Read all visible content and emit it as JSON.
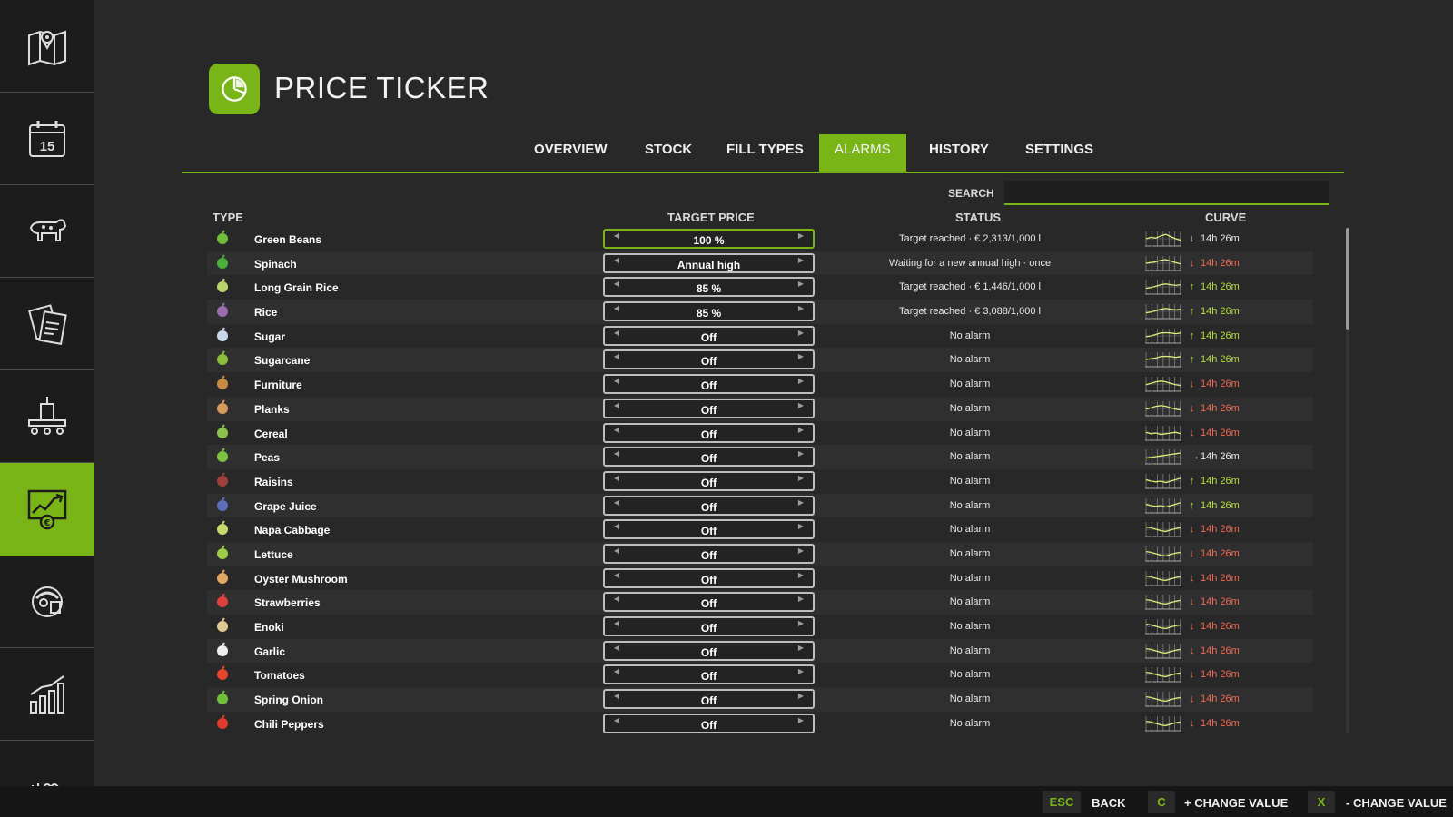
{
  "sidebar": {
    "items": [
      {
        "icon": "map-icon",
        "active": false
      },
      {
        "icon": "calendar-icon",
        "active": false,
        "label": "15"
      },
      {
        "icon": "livestock-icon",
        "active": false
      },
      {
        "icon": "contracts-icon",
        "active": false
      },
      {
        "icon": "production-icon",
        "active": false
      },
      {
        "icon": "price-chart-icon",
        "active": true
      },
      {
        "icon": "worker-icon",
        "active": false
      },
      {
        "icon": "statistics-icon",
        "active": false
      },
      {
        "icon": "more-icon",
        "active": false
      }
    ]
  },
  "header": {
    "title": "PRICE TICKER",
    "icon": "pie-chart-icon"
  },
  "tabs": [
    {
      "label": "OVERVIEW",
      "active": false
    },
    {
      "label": "STOCK",
      "active": false
    },
    {
      "label": "FILL TYPES",
      "active": false
    },
    {
      "label": "ALARMS",
      "active": true
    },
    {
      "label": "HISTORY",
      "active": false
    },
    {
      "label": "SETTINGS",
      "active": false
    }
  ],
  "search": {
    "label": "SEARCH",
    "placeholder": ""
  },
  "columns": {
    "type": "TYPE",
    "target": "TARGET PRICE",
    "status": "STATUS",
    "curve": "CURVE"
  },
  "rows": [
    {
      "name": "Green Beans",
      "icon": "green-beans-icon",
      "icon_color": "#6fbf3a",
      "target": "100 %",
      "status": "Target reached · € 2,313/1,000 l",
      "trend": "down",
      "trend_arrow": "↓",
      "time": "14h 26m",
      "time_color": "neutral",
      "curve": [
        0.5,
        0.4,
        0.45,
        0.3,
        0.2,
        0.35,
        0.5,
        0.6
      ]
    },
    {
      "name": "Spinach",
      "icon": "spinach-icon",
      "icon_color": "#4caf3a",
      "target": "Annual high",
      "status": "Waiting for a new annual high · once",
      "trend": "down",
      "trend_arrow": "↓",
      "time": "14h 26m",
      "time_color": "down",
      "curve": [
        0.5,
        0.45,
        0.4,
        0.3,
        0.25,
        0.35,
        0.45,
        0.55
      ]
    },
    {
      "name": "Long Grain Rice",
      "icon": "long-grain-rice-icon",
      "icon_color": "#b8d36a",
      "target": "85 %",
      "status": "Target reached · € 1,446/1,000 l",
      "trend": "up",
      "trend_arrow": "↑",
      "time": "14h 26m",
      "time_color": "up",
      "curve": [
        0.6,
        0.55,
        0.45,
        0.35,
        0.3,
        0.35,
        0.4,
        0.35
      ]
    },
    {
      "name": "Rice",
      "icon": "rice-icon",
      "icon_color": "#9a6cae",
      "target": "85 %",
      "status": "Target reached · € 3,088/1,000 l",
      "trend": "up",
      "trend_arrow": "↑",
      "time": "14h 26m",
      "time_color": "up",
      "curve": [
        0.6,
        0.55,
        0.45,
        0.35,
        0.3,
        0.35,
        0.4,
        0.35
      ]
    },
    {
      "name": "Sugar",
      "icon": "sugar-icon",
      "icon_color": "#c9d6ea",
      "target": "Off",
      "status": "No alarm",
      "trend": "up",
      "trend_arrow": "↑",
      "time": "14h 26m",
      "time_color": "up",
      "curve": [
        0.55,
        0.5,
        0.4,
        0.3,
        0.28,
        0.3,
        0.35,
        0.3
      ]
    },
    {
      "name": "Sugarcane",
      "icon": "sugarcane-icon",
      "icon_color": "#8bbf3a",
      "target": "Off",
      "status": "No alarm",
      "trend": "up",
      "trend_arrow": "↑",
      "time": "14h 26m",
      "time_color": "up",
      "curve": [
        0.5,
        0.45,
        0.4,
        0.3,
        0.28,
        0.3,
        0.35,
        0.3
      ]
    },
    {
      "name": "Furniture",
      "icon": "furniture-icon",
      "icon_color": "#c98a45",
      "target": "Off",
      "status": "No alarm",
      "trend": "down",
      "trend_arrow": "↓",
      "time": "14h 26m",
      "time_color": "down",
      "curve": [
        0.55,
        0.45,
        0.35,
        0.3,
        0.35,
        0.45,
        0.55,
        0.6
      ]
    },
    {
      "name": "Planks",
      "icon": "planks-icon",
      "icon_color": "#d49a5a",
      "target": "Off",
      "status": "No alarm",
      "trend": "down",
      "trend_arrow": "↓",
      "time": "14h 26m",
      "time_color": "down",
      "curve": [
        0.55,
        0.45,
        0.35,
        0.3,
        0.35,
        0.45,
        0.55,
        0.6
      ]
    },
    {
      "name": "Cereal",
      "icon": "cereal-icon",
      "icon_color": "#8bc34a",
      "target": "Off",
      "status": "No alarm",
      "trend": "down",
      "trend_arrow": "↓",
      "time": "14h 26m",
      "time_color": "down",
      "curve": [
        0.45,
        0.55,
        0.5,
        0.6,
        0.55,
        0.5,
        0.45,
        0.55
      ]
    },
    {
      "name": "Peas",
      "icon": "peas-icon",
      "icon_color": "#7cc242",
      "target": "Off",
      "status": "No alarm",
      "trend": "neutral",
      "trend_arrow": "→",
      "time": "14h 26m",
      "time_color": "neutral",
      "curve": [
        0.6,
        0.55,
        0.5,
        0.45,
        0.4,
        0.35,
        0.3,
        0.25
      ]
    },
    {
      "name": "Raisins",
      "icon": "raisins-icon",
      "icon_color": "#a0403a",
      "target": "Off",
      "status": "No alarm",
      "trend": "up",
      "trend_arrow": "↑",
      "time": "14h 26m",
      "time_color": "up",
      "curve": [
        0.4,
        0.5,
        0.55,
        0.5,
        0.6,
        0.5,
        0.4,
        0.3
      ]
    },
    {
      "name": "Grape Juice",
      "icon": "grape-juice-icon",
      "icon_color": "#5a6fb8",
      "target": "Off",
      "status": "No alarm",
      "trend": "up",
      "trend_arrow": "↑",
      "time": "14h 26m",
      "time_color": "up",
      "curve": [
        0.4,
        0.5,
        0.55,
        0.5,
        0.6,
        0.5,
        0.4,
        0.3
      ]
    },
    {
      "name": "Napa Cabbage",
      "icon": "napa-cabbage-icon",
      "icon_color": "#c8d86a",
      "target": "Off",
      "status": "No alarm",
      "trend": "down",
      "trend_arrow": "↓",
      "time": "14h 26m",
      "time_color": "down",
      "curve": [
        0.35,
        0.4,
        0.5,
        0.6,
        0.65,
        0.55,
        0.45,
        0.4
      ]
    },
    {
      "name": "Lettuce",
      "icon": "lettuce-icon",
      "icon_color": "#9ccc45",
      "target": "Off",
      "status": "No alarm",
      "trend": "down",
      "trend_arrow": "↓",
      "time": "14h 26m",
      "time_color": "down",
      "curve": [
        0.35,
        0.4,
        0.5,
        0.6,
        0.65,
        0.55,
        0.45,
        0.4
      ]
    },
    {
      "name": "Oyster Mushroom",
      "icon": "oyster-mushroom-icon",
      "icon_color": "#e0a860",
      "target": "Off",
      "status": "No alarm",
      "trend": "down",
      "trend_arrow": "↓",
      "time": "14h 26m",
      "time_color": "down",
      "curve": [
        0.35,
        0.4,
        0.5,
        0.6,
        0.65,
        0.55,
        0.45,
        0.4
      ]
    },
    {
      "name": "Strawberries",
      "icon": "strawberries-icon",
      "icon_color": "#e04040",
      "target": "Off",
      "status": "No alarm",
      "trend": "down",
      "trend_arrow": "↓",
      "time": "14h 26m",
      "time_color": "down",
      "curve": [
        0.35,
        0.4,
        0.5,
        0.6,
        0.65,
        0.55,
        0.45,
        0.4
      ]
    },
    {
      "name": "Enoki",
      "icon": "enoki-icon",
      "icon_color": "#e0c890",
      "target": "Off",
      "status": "No alarm",
      "trend": "down",
      "trend_arrow": "↓",
      "time": "14h 26m",
      "time_color": "down",
      "curve": [
        0.35,
        0.4,
        0.5,
        0.6,
        0.65,
        0.55,
        0.45,
        0.4
      ]
    },
    {
      "name": "Garlic",
      "icon": "garlic-icon",
      "icon_color": "#eeeeee",
      "target": "Off",
      "status": "No alarm",
      "trend": "down",
      "trend_arrow": "↓",
      "time": "14h 26m",
      "time_color": "down",
      "curve": [
        0.35,
        0.4,
        0.5,
        0.6,
        0.65,
        0.55,
        0.45,
        0.4
      ]
    },
    {
      "name": "Tomatoes",
      "icon": "tomatoes-icon",
      "icon_color": "#e8452a",
      "target": "Off",
      "status": "No alarm",
      "trend": "down",
      "trend_arrow": "↓",
      "time": "14h 26m",
      "time_color": "down",
      "curve": [
        0.35,
        0.4,
        0.5,
        0.6,
        0.65,
        0.55,
        0.45,
        0.4
      ]
    },
    {
      "name": "Spring Onion",
      "icon": "spring-onion-icon",
      "icon_color": "#6fbf3a",
      "target": "Off",
      "status": "No alarm",
      "trend": "down",
      "trend_arrow": "↓",
      "time": "14h 26m",
      "time_color": "down",
      "curve": [
        0.35,
        0.4,
        0.5,
        0.6,
        0.65,
        0.55,
        0.45,
        0.4
      ]
    },
    {
      "name": "Chili Peppers",
      "icon": "chili-peppers-icon",
      "icon_color": "#e03a2a",
      "target": "Off",
      "status": "No alarm",
      "trend": "down",
      "trend_arrow": "↓",
      "time": "14h 26m",
      "time_color": "down",
      "curve": [
        0.35,
        0.4,
        0.5,
        0.6,
        0.65,
        0.55,
        0.45,
        0.4
      ]
    }
  ],
  "footer": [
    {
      "key": "ESC",
      "label": "BACK"
    },
    {
      "key": "C",
      "label": "+ CHANGE VALUE"
    },
    {
      "key": "X",
      "label": "- CHANGE VALUE"
    }
  ],
  "colors": {
    "accent": "#7ab518",
    "up": "#b6e03a",
    "down": "#f26a52",
    "background": "#282828",
    "sidebar": "#1c1c1c"
  }
}
